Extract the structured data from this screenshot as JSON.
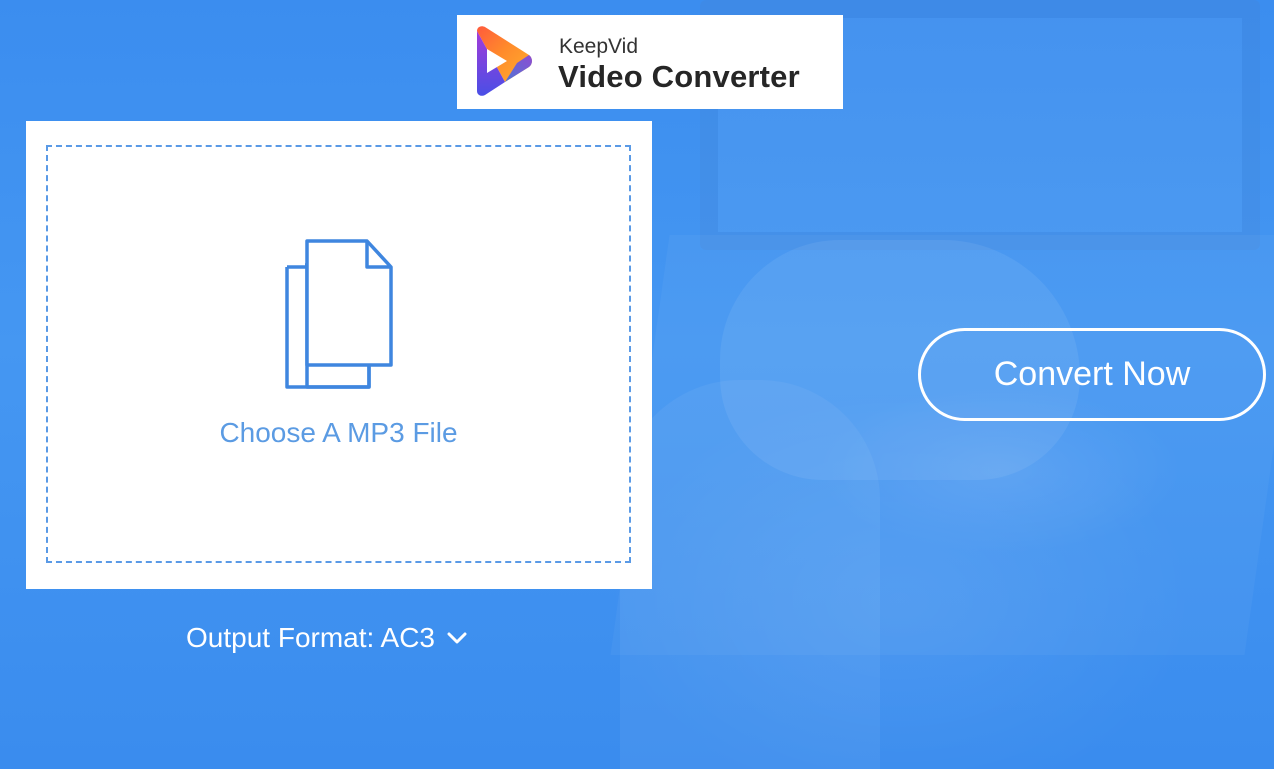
{
  "logo": {
    "small_text": "KeepVid",
    "big_text": "Video Converter",
    "icon": "play-logo-icon"
  },
  "upload": {
    "label": "Choose A MP3 File",
    "icon": "files-icon"
  },
  "convert": {
    "label": "Convert Now"
  },
  "output_format": {
    "label": "Output Format: AC3",
    "icon": "chevron-down-icon"
  },
  "colors": {
    "background": "#3d8ff0",
    "accent": "#5b9be3",
    "white": "#ffffff"
  }
}
